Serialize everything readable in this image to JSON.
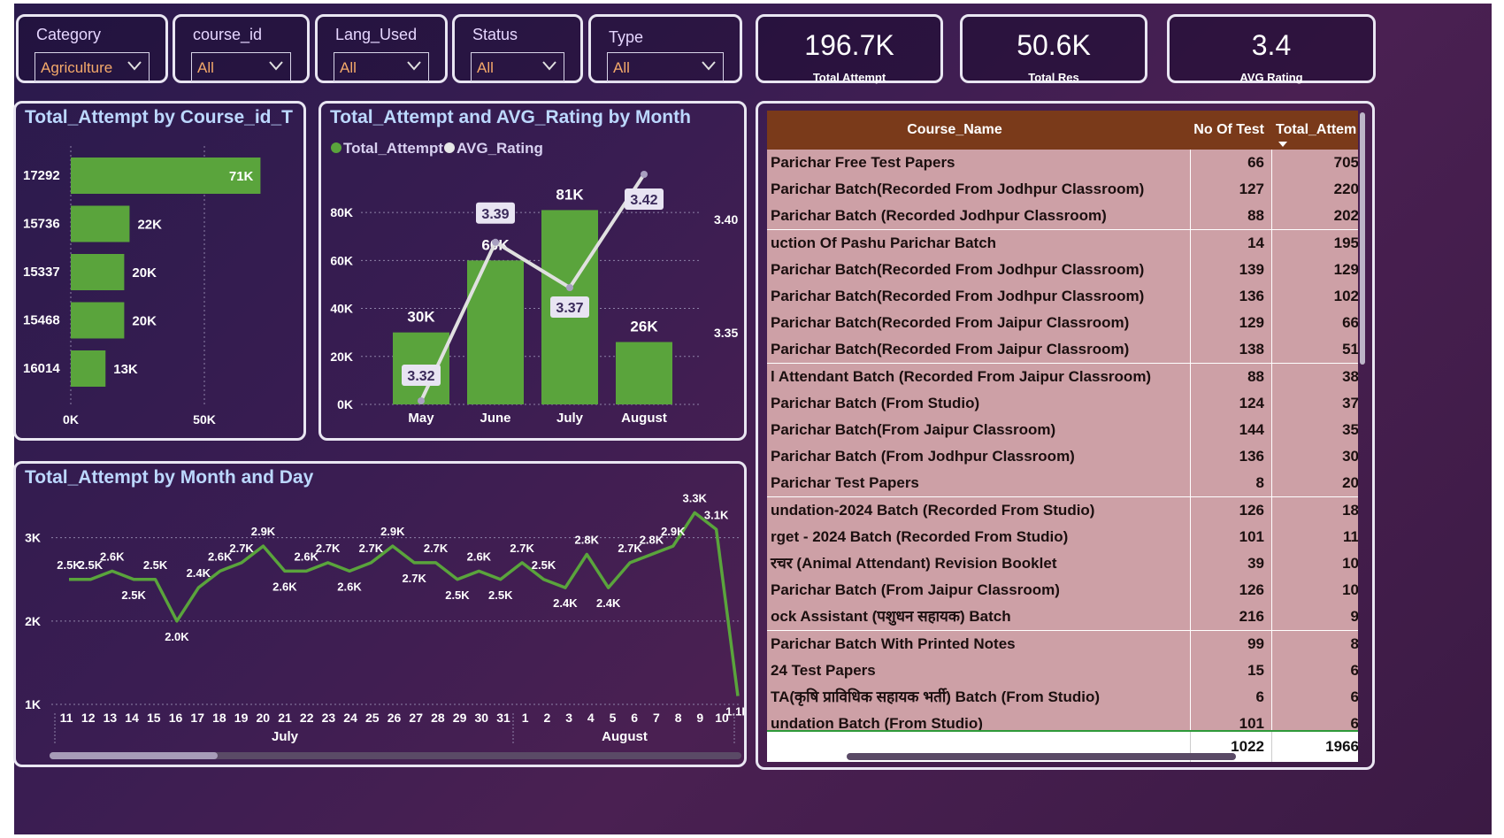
{
  "slicers": [
    {
      "title": "Category",
      "value": "Agriculture"
    },
    {
      "title": "course_id",
      "value": "All"
    },
    {
      "title": "Lang_Used",
      "value": "All"
    },
    {
      "title": "Status",
      "value": "All"
    },
    {
      "title": "Type",
      "value": "All"
    }
  ],
  "cards": [
    {
      "value": "196.7K",
      "label": "Total Attempt"
    },
    {
      "value": "50.6K",
      "label": "Total Res"
    },
    {
      "value": "3.4",
      "label": "AVG Rating"
    }
  ],
  "icons": {
    "dropdown": "chevron-down-icon",
    "sort": "sort-desc-icon"
  },
  "colors": {
    "bar": "#5aa43c",
    "line": "#e0e0e0",
    "header": "#7a3a1a",
    "row": "#cda0a6"
  },
  "chart_data": [
    {
      "type": "bar",
      "title": "Total_Attempt by Course_id_T",
      "categories": [
        "17292",
        "15736",
        "15337",
        "15468",
        "16014"
      ],
      "values": [
        71000,
        22000,
        20000,
        20000,
        13000
      ],
      "data_labels": [
        "71K",
        "22K",
        "20K",
        "20K",
        "13K"
      ],
      "xticks": [
        "0K",
        "50K"
      ],
      "xlim": [
        0,
        100000
      ],
      "orientation": "horizontal"
    },
    {
      "type": "bar",
      "title": "Total_Attempt and AVG_Rating by Month",
      "legend": [
        "Total_Attempt",
        "AVG_Rating"
      ],
      "categories": [
        "May",
        "June",
        "July",
        "August"
      ],
      "series": [
        {
          "name": "Total_Attempt",
          "values": [
            30000,
            60000,
            81000,
            26000
          ],
          "labels": [
            "30K",
            "60K",
            "81K",
            "26K"
          ]
        },
        {
          "name": "AVG_Rating",
          "values": [
            3.32,
            3.39,
            3.37,
            3.42
          ],
          "labels": [
            "3.32",
            "3.39",
            "3.37",
            "3.42"
          ]
        }
      ],
      "yticks": [
        "0K",
        "20K",
        "40K",
        "60K",
        "80K"
      ],
      "ylim": [
        0,
        90000
      ],
      "y2ticks": [
        "3.35",
        "3.40"
      ],
      "y2lim": [
        3.32,
        3.42
      ]
    },
    {
      "type": "line",
      "title": "Total_Attempt by Month and Day",
      "x": [
        "11",
        "12",
        "13",
        "14",
        "15",
        "16",
        "17",
        "18",
        "19",
        "20",
        "21",
        "22",
        "23",
        "24",
        "25",
        "26",
        "27",
        "28",
        "29",
        "30",
        "31",
        "1",
        "2",
        "3",
        "4",
        "5",
        "6",
        "7",
        "8",
        "9",
        "10"
      ],
      "groups": [
        {
          "label": "July"
        },
        {
          "label": "August"
        }
      ],
      "values": [
        2500,
        2500,
        2600,
        2500,
        2500,
        2000,
        2400,
        2600,
        2700,
        2900,
        2600,
        2600,
        2700,
        2600,
        2700,
        2900,
        2700,
        2700,
        2500,
        2600,
        2500,
        2700,
        2500,
        2400,
        2800,
        2400,
        2700,
        2800,
        2900,
        3300,
        3100,
        1100
      ],
      "labels": [
        "2.5K",
        "2.5K",
        "2.6K",
        "2.5K",
        "2.5K",
        "2.0K",
        "2.4K",
        "2.6K",
        "2.7K",
        "2.9K",
        "2.6K",
        "2.6K",
        "2.7K",
        "2.6K",
        "2.7K",
        "2.9K",
        "2.7K",
        "2.7K",
        "2.5K",
        "2.6K",
        "2.5K",
        "2.7K",
        "2.5K",
        "2.4K",
        "2.8K",
        "2.4K",
        "2.7K",
        "2.8K",
        "2.9K",
        "3.3K",
        "3.1K",
        "1.1K"
      ],
      "yticks": [
        "1K",
        "2K",
        "3K"
      ],
      "ylim": [
        1000,
        3400
      ]
    }
  ],
  "table": {
    "headers": [
      "Course_Name",
      "No Of Test",
      "Total_Attem"
    ],
    "rows": [
      [
        "Parichar Free Test Papers",
        "66",
        "705"
      ],
      [
        "Parichar Batch(Recorded From Jodhpur Classroom)",
        "127",
        "220"
      ],
      [
        "Parichar Batch (Recorded Jodhpur Classroom)",
        "88",
        "202"
      ],
      [
        "uction Of Pashu Parichar Batch",
        "14",
        "195"
      ],
      [
        "Parichar Batch(Recorded From Jodhpur Classroom)",
        "139",
        "129"
      ],
      [
        "Parichar Batch(Recorded From Jodhpur Classroom)",
        "136",
        "102"
      ],
      [
        "Parichar Batch(Recorded From Jaipur Classroom)",
        "129",
        "66"
      ],
      [
        "Parichar Batch(Recorded From Jaipur Classroom)",
        "138",
        "51"
      ],
      [
        "l Attendant Batch (Recorded From Jaipur Classroom)",
        "88",
        "38"
      ],
      [
        "Parichar Batch (From Studio)",
        "124",
        "37"
      ],
      [
        "Parichar Batch(From Jaipur Classroom)",
        "144",
        "35"
      ],
      [
        "Parichar Batch (From Jodhpur Classroom)",
        "136",
        "30"
      ],
      [
        "Parichar Test Papers",
        "8",
        "20"
      ],
      [
        "undation-2024 Batch (Recorded From Studio)",
        "126",
        "18"
      ],
      [
        "rget - 2024 Batch (Recorded From Studio)",
        "101",
        "11"
      ],
      [
        "रचर (Animal Attendant) Revision Booklet",
        "39",
        "10"
      ],
      [
        "Parichar Batch (From Jaipur Classroom)",
        "126",
        "10"
      ],
      [
        "ock Assistant (पशुधन सहायक) Batch",
        "216",
        "9"
      ],
      [
        "Parichar Batch With Printed Notes",
        "99",
        "8"
      ],
      [
        "24 Test Papers",
        "15",
        "6"
      ],
      [
        "TA(कृषि प्राविधिक सहायक भर्ती) Batch (From Studio)",
        "6",
        "6"
      ],
      [
        "undation Batch (From Studio)",
        "101",
        "6"
      ]
    ],
    "total": [
      "",
      "1022",
      "1966"
    ]
  }
}
